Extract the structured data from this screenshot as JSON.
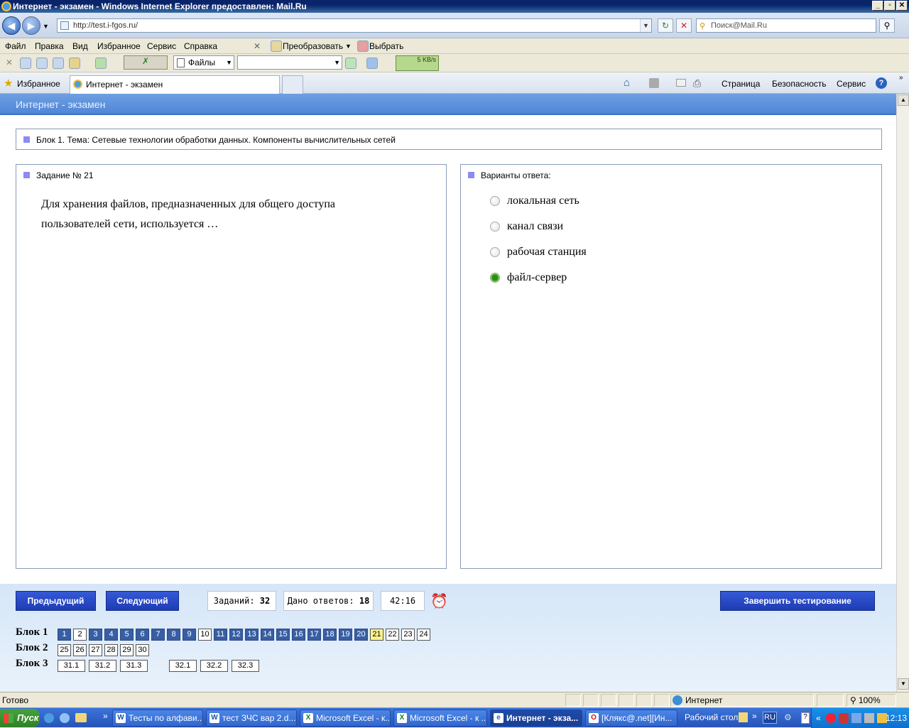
{
  "window": {
    "title": "Интернет - экзамен - Windows Internet Explorer предоставлен: Mail.Ru",
    "btn_min": "_",
    "btn_max": "▫",
    "btn_close": "✕"
  },
  "addressbar": {
    "url": "http://test.i-fgos.ru/",
    "search_placeholder": "Поиск@Mail.Ru"
  },
  "menu": {
    "items": [
      "Файл",
      "Правка",
      "Вид",
      "Избранное",
      "Сервис",
      "Справка"
    ],
    "convert": "Преобразовать",
    "select": "Выбрать"
  },
  "toolbar": {
    "files": "Файлы",
    "speed": "5 KB/s"
  },
  "favorites": {
    "label": "Избранное",
    "tab_title": "Интернет - экзамен",
    "cmd_page": "Страница",
    "cmd_security": "Безопасность",
    "cmd_service": "Сервис"
  },
  "page": {
    "header": "Интернет - экзамен",
    "block_title": "Блок 1. Тема: Сетевые технологии обработки данных. Компоненты вычислительных сетей",
    "task_label": "Задание № 21",
    "question_line1": "Для хранения файлов, предназначенных для общего доступа",
    "question_line2": "пользователей сети, используется …",
    "answers_label": "Варианты ответа:",
    "answers": [
      {
        "text": "локальная сеть",
        "checked": false
      },
      {
        "text": "канал связи",
        "checked": false
      },
      {
        "text": "рабочая станция",
        "checked": false
      },
      {
        "text": "файл-сервер",
        "checked": true
      }
    ],
    "prev_button": "Предыдущий",
    "next_button": "Следующий",
    "tasks_count_label": "Заданий:",
    "tasks_count": "32",
    "answered_label": "Дано ответов:",
    "answered_count": "18",
    "timer": "42:16",
    "finish_button": "Завершить тестирование",
    "blocks": [
      {
        "label": "Блок 1",
        "items": [
          "1",
          "2",
          "3",
          "4",
          "5",
          "6",
          "7",
          "8",
          "9",
          "10",
          "11",
          "12",
          "13",
          "14",
          "15",
          "16",
          "17",
          "18",
          "19",
          "20",
          "21",
          "22",
          "23",
          "24"
        ],
        "done": [
          "1",
          "3",
          "4",
          "5",
          "6",
          "7",
          "8",
          "9",
          "11",
          "12",
          "13",
          "14",
          "15",
          "16",
          "17",
          "18",
          "19",
          "20"
        ],
        "current": "21"
      },
      {
        "label": "Блок 2",
        "items": [
          "25",
          "26",
          "27",
          "28",
          "29",
          "30"
        ],
        "done": [],
        "current": null
      },
      {
        "label": "Блок 3",
        "items": [
          "31.1",
          "31.2",
          "31.3",
          "32.1",
          "32.2",
          "32.3"
        ],
        "done": [],
        "current": null
      }
    ]
  },
  "statusbar": {
    "status": "Готово",
    "zone": "Интернет",
    "zoom": "100%"
  },
  "taskbar": {
    "start": "Пуск",
    "tasks": [
      {
        "label": "Тесты по алфави...",
        "icon": "W"
      },
      {
        "label": "тест ЗЧС вар 2.d...",
        "icon": "W"
      },
      {
        "label": "Microsoft Excel - к...",
        "icon": "X"
      },
      {
        "label": "Microsoft Excel - к ...",
        "icon": "X"
      },
      {
        "label": "Интернет - экза...",
        "icon": "e"
      },
      {
        "label": "[Клякс@.net][Ин...",
        "icon": "O"
      }
    ],
    "desktop": "Рабочий стол",
    "lang": "RU",
    "clock": "12:13"
  },
  "colors": {
    "header_blue": "#4f86d8",
    "done_blue": "#385ea3",
    "current_yellow": "#fbf48a",
    "selected_green": "#2f8c16",
    "button_blue": "#1e3cb4"
  }
}
